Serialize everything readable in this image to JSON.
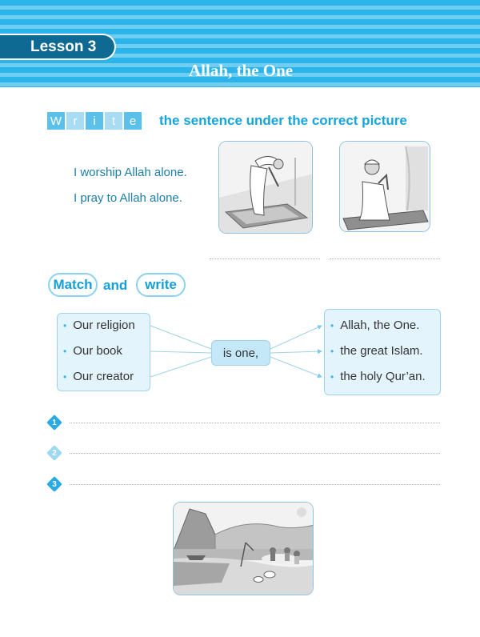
{
  "header": {
    "lesson_label": "Lesson 3",
    "title": "Allah, the One"
  },
  "write_section": {
    "letters": [
      "W",
      "r",
      "i",
      "t",
      "e"
    ],
    "instruction": "the sentence under the correct picture",
    "sentences": [
      "I worship Allah alone.",
      "I pray to Allah alone."
    ]
  },
  "match_section": {
    "heading_match": "Match",
    "heading_and": "and",
    "heading_write": "write",
    "left_items": [
      "Our religion",
      "Our book",
      "Our creator"
    ],
    "center": "is one,",
    "right_items": [
      "Allah, the One.",
      "the great Islam.",
      "the holy Qur’an."
    ],
    "answer_numbers": [
      "1",
      "2",
      "3"
    ]
  },
  "colors": {
    "header_stripe": "#2ab4ea",
    "lesson_tab": "#0f6a93",
    "accent_text": "#16a4dc",
    "box_fill": "#e3f4fc"
  }
}
